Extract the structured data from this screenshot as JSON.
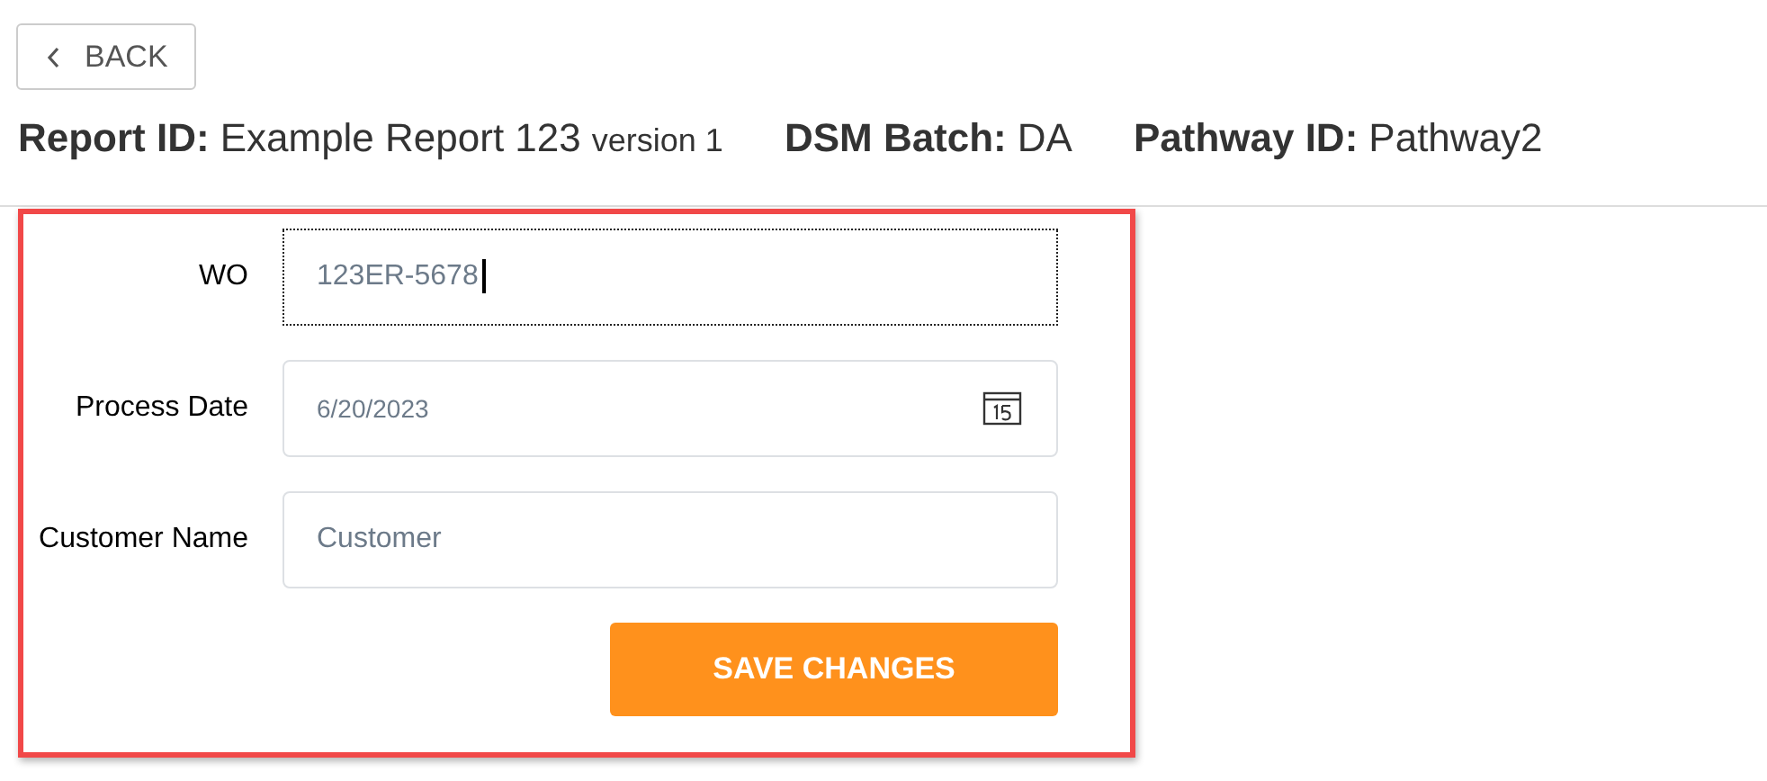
{
  "back_button": {
    "label": "BACK"
  },
  "header": [
    {
      "label": "Report ID:",
      "value": "Example Report 123",
      "note": "version 1"
    },
    {
      "label": "DSM Batch:",
      "value": "DA"
    },
    {
      "label": "Pathway ID:",
      "value": "Pathway2"
    }
  ],
  "form": {
    "fields": [
      {
        "kind": "text",
        "label": "WO",
        "value": "123ER-5678",
        "focused": true
      },
      {
        "kind": "date",
        "label": "Process Date",
        "value": "6/20/2023",
        "focused": false
      },
      {
        "kind": "text",
        "label": "Customer Name",
        "placeholder": "Customer",
        "focused": false
      }
    ],
    "submit": "SAVE CHANGES"
  }
}
